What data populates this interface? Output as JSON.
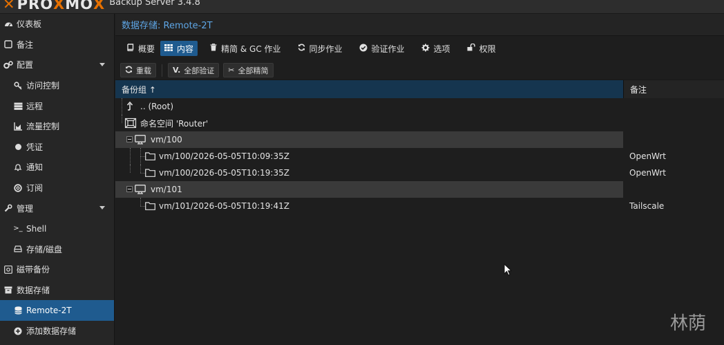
{
  "app": {
    "logo_letters": [
      "P",
      "R",
      "O",
      "X",
      "M",
      "O",
      "X"
    ],
    "subtitle": "Backup Server 3.4.8",
    "accent": "#e57000",
    "selection_color": "#1f5b8f"
  },
  "sidebar": {
    "items": [
      {
        "label": "仪表板",
        "icon": "dashboard-icon",
        "level": 1
      },
      {
        "label": "备注",
        "icon": "notes-icon",
        "level": 1
      },
      {
        "label": "配置",
        "icon": "gears-icon",
        "level": 1,
        "expanded": true
      },
      {
        "label": "访问控制",
        "icon": "key-icon",
        "level": 2
      },
      {
        "label": "远程",
        "icon": "server-icon",
        "level": 2
      },
      {
        "label": "流量控制",
        "icon": "area-chart-icon",
        "level": 2
      },
      {
        "label": "凭证",
        "icon": "certificate-icon",
        "level": 2
      },
      {
        "label": "通知",
        "icon": "bell-icon",
        "level": 2
      },
      {
        "label": "订阅",
        "icon": "support-icon",
        "level": 2
      },
      {
        "label": "管理",
        "icon": "wrench-icon",
        "level": 1,
        "expanded": true
      },
      {
        "label": "Shell",
        "icon": "terminal-icon",
        "level": 2
      },
      {
        "label": "存储/磁盘",
        "icon": "hdd-icon",
        "level": 2
      },
      {
        "label": "磁带备份",
        "icon": "tape-icon",
        "level": 1
      },
      {
        "label": "数据存储",
        "icon": "archive-icon",
        "level": 1
      },
      {
        "label": "Remote-2T",
        "icon": "database-icon",
        "level": 2,
        "active": true
      },
      {
        "label": "添加数据存储",
        "icon": "plus-circle-icon",
        "level": 2
      }
    ]
  },
  "panel": {
    "title": "数据存储: Remote-2T",
    "tabs": [
      {
        "label": "概要",
        "icon": "book-icon"
      },
      {
        "label": "内容",
        "icon": "th-icon",
        "active": true
      },
      {
        "label": "精简 & GC 作业",
        "icon": "trash-icon"
      },
      {
        "label": "同步作业",
        "icon": "refresh-icon"
      },
      {
        "label": "验证作业",
        "icon": "check-circle-icon"
      },
      {
        "label": "选项",
        "icon": "gear-icon"
      },
      {
        "label": "权限",
        "icon": "unlock-icon"
      }
    ],
    "toolbar": {
      "reload": "重载",
      "verify_all": "全部验证",
      "prune_all": "全部精简"
    },
    "columns": {
      "group": "备份组 ↑",
      "comment": "备注"
    },
    "rows": [
      {
        "kind": "root",
        "label": ".. (Root)",
        "comment": "",
        "depth": 0
      },
      {
        "kind": "namespace",
        "label": "命名空间 'Router'",
        "comment": "",
        "depth": 0
      },
      {
        "kind": "group",
        "label": "vm/100",
        "comment": "",
        "depth": 1,
        "selected": true
      },
      {
        "kind": "snapshot",
        "label": "vm/100/2026-05-05T10:09:35Z",
        "comment": "OpenWrt",
        "depth": 2
      },
      {
        "kind": "snapshot",
        "label": "vm/100/2026-05-05T10:19:35Z",
        "comment": "OpenWrt",
        "depth": 2
      },
      {
        "kind": "group",
        "label": "vm/101",
        "comment": "",
        "depth": 1,
        "selected": true
      },
      {
        "kind": "snapshot",
        "label": "vm/101/2026-05-05T10:19:41Z",
        "comment": "Tailscale",
        "depth": 2
      }
    ]
  },
  "watermark": "林荫"
}
